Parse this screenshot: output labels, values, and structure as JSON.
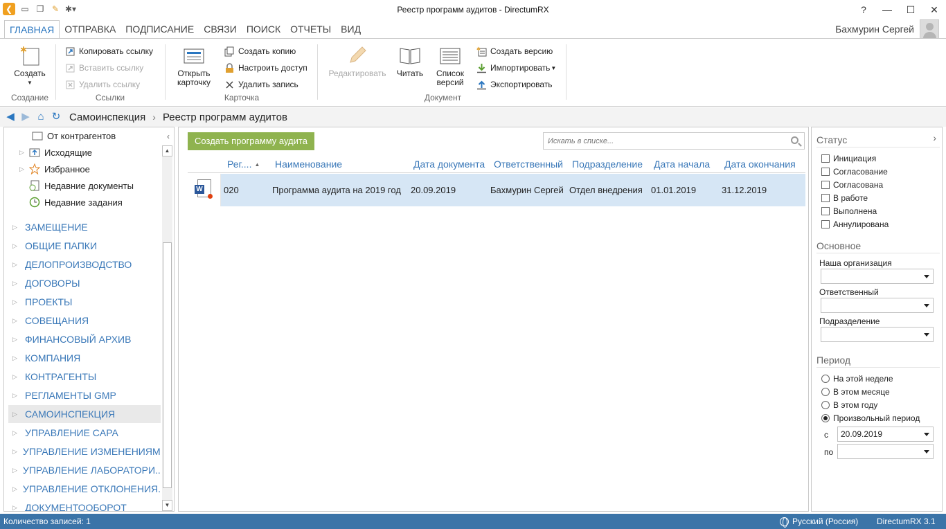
{
  "window": {
    "title": "Реестр программ аудитов - DirectumRX"
  },
  "title_controls": {
    "help": "?",
    "minimize": "—",
    "maximize": "☐",
    "close": "✕"
  },
  "ribbon_tabs": [
    "ГЛАВНАЯ",
    "ОТПРАВКА",
    "ПОДПИСАНИЕ",
    "СВЯЗИ",
    "ПОИСК",
    "ОТЧЕТЫ",
    "ВИД"
  ],
  "user": {
    "name": "Бахмурин Сергей"
  },
  "ribbon": {
    "create": {
      "label": "Создать",
      "group": "Создание"
    },
    "links": {
      "group": "Ссылки",
      "copy": "Копировать ссылку",
      "paste": "Вставить ссылку",
      "delete": "Удалить ссылку"
    },
    "card": {
      "group": "Карточка",
      "open_line1": "Открыть",
      "open_line2": "карточку",
      "copy": "Создать копию",
      "access": "Настроить доступ",
      "delete": "Удалить запись"
    },
    "document": {
      "group": "Документ",
      "edit": "Редактировать",
      "read": "Читать",
      "versions_line1": "Список",
      "versions_line2": "версий",
      "create_version": "Создать версию",
      "import": "Импортировать",
      "export": "Экспортировать"
    }
  },
  "breadcrumb": {
    "items": [
      "Самоинспекция",
      "Реестр программ аудитов"
    ]
  },
  "nav_tree": {
    "items": [
      {
        "label": "От контрагентов"
      },
      {
        "label": "Исходящие"
      },
      {
        "label": "Избранное"
      },
      {
        "label": "Недавние документы"
      },
      {
        "label": "Недавние задания"
      }
    ],
    "sections": [
      "ЗАМЕЩЕНИЕ",
      "ОБЩИЕ ПАПКИ",
      "ДЕЛОПРОИЗВОДСТВО",
      "ДОГОВОРЫ",
      "ПРОЕКТЫ",
      "СОВЕЩАНИЯ",
      "ФИНАНСОВЫЙ АРХИВ",
      "КОМПАНИЯ",
      "КОНТРАГЕНТЫ",
      "РЕГЛАМЕНТЫ GMP",
      "САМОИНСПЕКЦИЯ",
      "УПРАВЛЕНИЕ CAPA",
      "УПРАВЛЕНИЕ ИЗМЕНЕНИЯМИ",
      "УПРАВЛЕНИЕ ЛАБОРАТОРИ...",
      "УПРАВЛЕНИЕ ОТКЛОНЕНИЯ...",
      "ДОКУМЕНТООБОРОТ"
    ],
    "selected": "САМОИНСПЕКЦИЯ"
  },
  "list": {
    "create_button": "Создать программу аудита",
    "search_placeholder": "Искать в списке...",
    "columns": [
      "Рег....",
      "Наименование",
      "Дата документа",
      "Ответственный",
      "Подразделение",
      "Дата начала",
      "Дата окончания"
    ],
    "rows": [
      [
        "020",
        "Программа аудита на 2019 год",
        "20.09.2019",
        "Бахмурин Сергей",
        "Отдел внедрения",
        "01.01.2019",
        "31.12.2019"
      ]
    ]
  },
  "filters": {
    "status_title": "Статус",
    "statuses": [
      "Инициация",
      "Согласование",
      "Согласована",
      "В работе",
      "Выполнена",
      "Аннулирована"
    ],
    "main_title": "Основное",
    "fields": [
      "Наша организация",
      "Ответственный",
      "Подразделение"
    ],
    "period_title": "Период",
    "periods": [
      "На этой неделе",
      "В этом месяце",
      "В этом году",
      "Произвольный период"
    ],
    "selected_period": "Произвольный период",
    "from_label": "с",
    "from_value": "20.09.2019",
    "to_label": "по",
    "to_value": ""
  },
  "status_bar": {
    "count": "Количество записей: 1",
    "language": "Русский (Россия)",
    "version": "DirectumRX 3.1"
  },
  "colors": {
    "accent": "#2b77c0",
    "create_button": "#8fb34f",
    "status_bar": "#3b74a8",
    "row_selected": "#d6e6f5"
  }
}
